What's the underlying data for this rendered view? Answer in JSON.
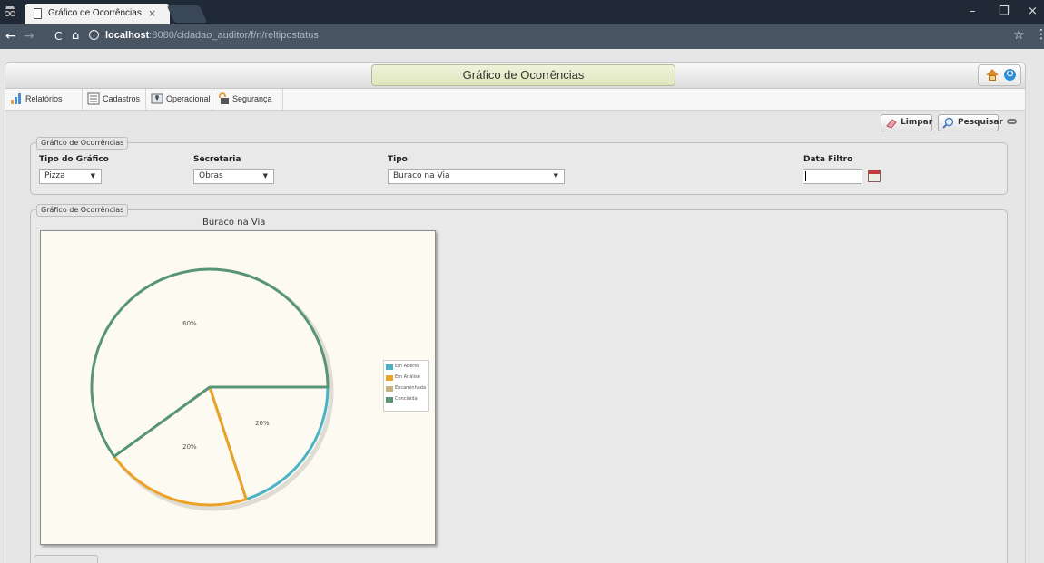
{
  "browser": {
    "tab_title": "Gráfico de Ocorrências",
    "tab_close": "×",
    "url_host": "localhost",
    "url_rest": ":8080/cidadao_auditor/f/n/reltipostatus",
    "info_glyph": "i",
    "back": "←",
    "forward": "→",
    "reload": "C",
    "home": "⌂",
    "star": "☆",
    "menu": "⋮",
    "minimize": "–",
    "maximize": "❐",
    "close": "×"
  },
  "header": {
    "title": "Gráfico de Ocorrências"
  },
  "menu": {
    "items": [
      {
        "label": "Relatórios",
        "icon": "bar-chart-icon"
      },
      {
        "label": "Cadastros",
        "icon": "list-icon"
      },
      {
        "label": "Operacional",
        "icon": "map-icon"
      },
      {
        "label": "Segurança",
        "icon": "lock-icon"
      }
    ]
  },
  "toolbar": {
    "clear_label": "Limpar",
    "search_label": "Pesquisar"
  },
  "filters": {
    "legend": "Gráfico de Ocorrências",
    "chart_type_label": "Tipo do Gráfico",
    "chart_type_value": "Pizza",
    "department_label": "Secretaria",
    "department_value": "Obras",
    "type_label": "Tipo",
    "type_value": "Buraco na Via",
    "date_label": "Data Filtro",
    "date_value": "",
    "arrow": "▼"
  },
  "chart_panel": {
    "legend": "Gráfico de Ocorrências"
  },
  "chart_data": {
    "type": "pie",
    "title": "Buraco na Via",
    "categories": [
      "Em Aberto",
      "Em Análise",
      "Encaminhada",
      "Concluída"
    ],
    "values": [
      20,
      20,
      0,
      60
    ],
    "labels": [
      "20%",
      "20%",
      "",
      "60%"
    ],
    "colors": [
      "#4bb2c5",
      "#eaa228",
      "#c5b47f",
      "#579575"
    ],
    "legend_position": "right"
  }
}
